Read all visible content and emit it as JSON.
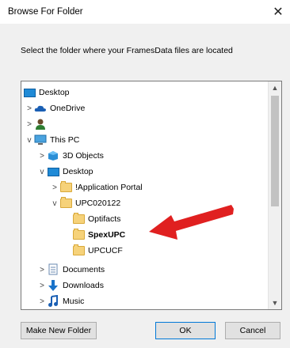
{
  "window": {
    "title": "Browse For Folder",
    "close_glyph": "✕"
  },
  "description": "Select the folder where your FramesData files are located",
  "tree": {
    "items": [
      {
        "label": "Desktop",
        "icon": "desktop-icon",
        "expander": "",
        "level": 0
      },
      {
        "label": "OneDrive",
        "icon": "cloud-icon",
        "expander": ">",
        "level": 1
      },
      {
        "label": "",
        "icon": "user-icon",
        "expander": ">",
        "level": 1
      },
      {
        "label": "This PC",
        "icon": "pc-icon",
        "expander": "v",
        "level": 1
      },
      {
        "label": "3D Objects",
        "icon": "3d-objects-icon",
        "expander": ">",
        "level": 2
      },
      {
        "label": "Desktop",
        "icon": "desktop-icon",
        "expander": "v",
        "level": 2
      },
      {
        "label": "!Application Portal",
        "icon": "folder-icon",
        "expander": ">",
        "level": 3
      },
      {
        "label": "UPC020122",
        "icon": "folder-icon",
        "expander": "v",
        "level": 3
      },
      {
        "label": "Optifacts",
        "icon": "folder-icon",
        "expander": "",
        "level": 4
      },
      {
        "label": "SpexUPC",
        "icon": "folder-icon",
        "expander": "",
        "level": 4,
        "selected": true
      },
      {
        "label": "UPCUCF",
        "icon": "folder-icon",
        "expander": "",
        "level": 4
      },
      {
        "label": "Documents",
        "icon": "documents-icon",
        "expander": ">",
        "level": 2
      },
      {
        "label": "Downloads",
        "icon": "download-icon",
        "expander": ">",
        "level": 2
      },
      {
        "label": "Music",
        "icon": "music-icon",
        "expander": ">",
        "level": 2
      }
    ]
  },
  "buttons": {
    "make_new_folder": "Make New Folder",
    "ok": "OK",
    "cancel": "Cancel"
  },
  "colors": {
    "accent": "#0078d7",
    "arrow": "#e02020",
    "folder": "#f6d27a"
  }
}
